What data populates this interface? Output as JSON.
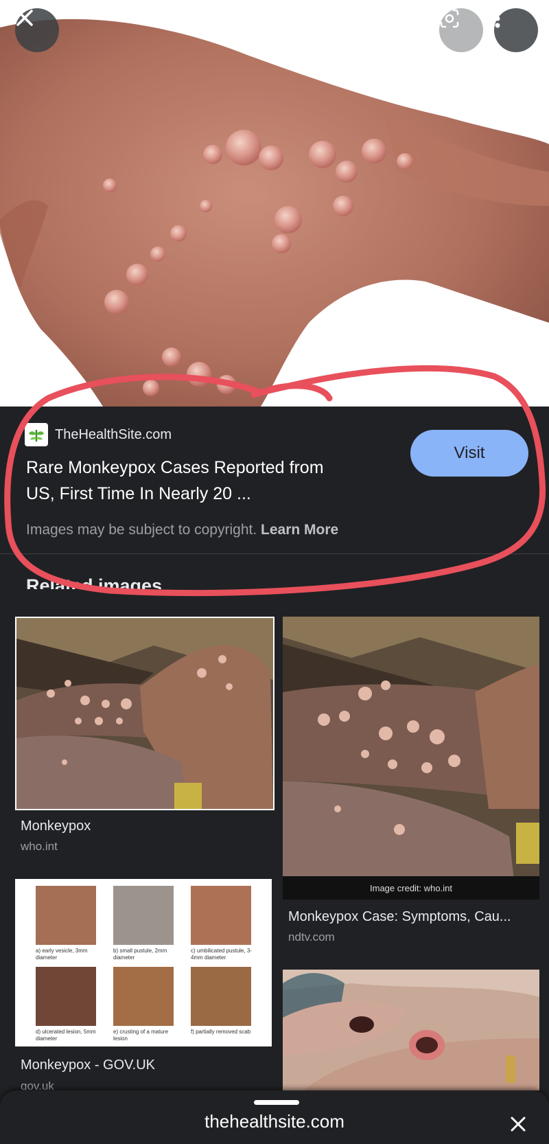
{
  "header_buttons": {
    "close_icon": "close-icon",
    "lens_icon": "google-lens-icon",
    "more_icon": "more-vert-icon"
  },
  "result": {
    "site_name": "TheHealthSite.com",
    "title_line1": "Rare Monkeypox Cases Reported from",
    "title_line2": "US, First Time In Nearly 20 ...",
    "visit_label": "Visit",
    "copyright_text": "Images may be subject to copyright.",
    "learn_more_label": "Learn More"
  },
  "related": {
    "heading": "Related images",
    "cards": [
      {
        "title": "Monkeypox",
        "source": "who.int"
      },
      {
        "title": "Monkeypox Case: Symptoms, Cau...",
        "source": "ndtv.com",
        "credit": "Image credit: who.int"
      },
      {
        "title": "Monkeypox - GOV.UK",
        "source": "gov.uk",
        "stages": [
          "a) early vesicle, 3mm diameter",
          "b) small pustule, 2mm diameter",
          "c) umbilicated pustule, 3-4mm diameter",
          "d) ulcerated lesion, 5mm diameter",
          "e) crusting of a mature lesion",
          "f) partially removed scab"
        ]
      }
    ]
  },
  "bottom_sheet": {
    "url": "thehealthsite.com",
    "close_icon": "close-icon"
  },
  "colors": {
    "background": "#202124",
    "visit_button": "#8ab4f8",
    "annotation": "#e8505b"
  }
}
